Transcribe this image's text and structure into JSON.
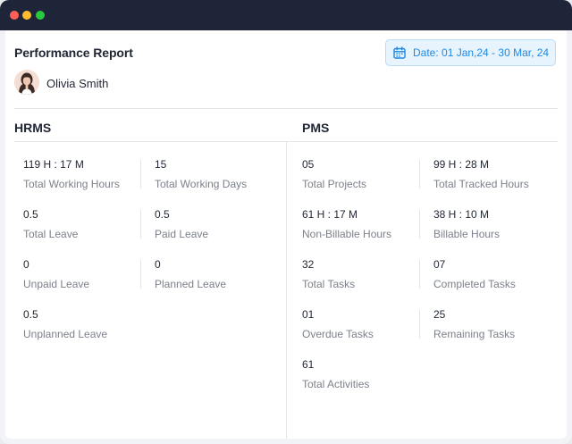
{
  "window": {
    "controls": [
      "close",
      "minimize",
      "maximize"
    ]
  },
  "header": {
    "title": "Performance Report",
    "date_label": "Date: 01 Jan,24 - 30 Mar, 24",
    "calendar_icon": "calendar-icon"
  },
  "user": {
    "name": "Olivia Smith"
  },
  "hrms": {
    "title": "HRMS",
    "stats": [
      {
        "value": "119 H : 17 M",
        "label": "Total Working Hours"
      },
      {
        "value": "15",
        "label": "Total Working Days"
      },
      {
        "value": "0.5",
        "label": "Total Leave"
      },
      {
        "value": "0.5",
        "label": "Paid Leave"
      },
      {
        "value": "0",
        "label": "Unpaid Leave"
      },
      {
        "value": "0",
        "label": "Planned Leave"
      },
      {
        "value": "0.5",
        "label": "Unplanned Leave"
      }
    ]
  },
  "pms": {
    "title": "PMS",
    "stats": [
      {
        "value": "05",
        "label": "Total Projects"
      },
      {
        "value": "99 H : 28 M",
        "label": "Total Tracked Hours"
      },
      {
        "value": "61 H : 17 M",
        "label": "Non-Billable Hours"
      },
      {
        "value": "38 H : 10 M",
        "label": "Billable Hours"
      },
      {
        "value": "32",
        "label": "Total Tasks"
      },
      {
        "value": "07",
        "label": "Completed Tasks"
      },
      {
        "value": "01",
        "label": "Overdue Tasks"
      },
      {
        "value": "25",
        "label": "Remaining Tasks"
      },
      {
        "value": "61",
        "label": "Total Activities"
      }
    ]
  },
  "colors": {
    "accent": "#1e88e5",
    "title_bar": "#1f2538",
    "label": "#7c818b",
    "text": "#1f2533"
  }
}
